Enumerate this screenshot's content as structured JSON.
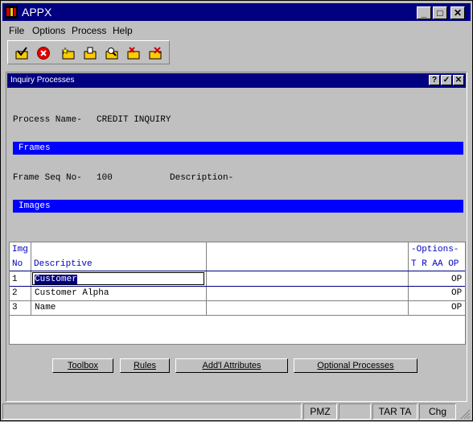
{
  "window": {
    "title": "APPX"
  },
  "menu": [
    "File",
    "Options",
    "Process",
    "Help"
  ],
  "toolbar_icons": [
    "check-folder-icon",
    "cancel-icon",
    "folder-star-icon",
    "folder-edit-icon",
    "folder-search-icon",
    "folder-delete-icon",
    "folder-x-icon"
  ],
  "inner": {
    "title": "Inquiry Processes",
    "buttons": [
      "?",
      "✓",
      "✕"
    ]
  },
  "process": {
    "label": "Process Name-",
    "value": "CREDIT INQUIRY"
  },
  "frames_band": "Frames",
  "frame": {
    "seq_label": "Frame Seq No-",
    "seq_value": "100",
    "desc_label": "Description-"
  },
  "images_band": "Images",
  "grid": {
    "header": {
      "img": "Img",
      "no": "No",
      "descriptive": "Descriptive",
      "options_title": "-Options-",
      "options_cols": "T R AA OP"
    },
    "rows": [
      {
        "no": "1",
        "descriptive": "Customer",
        "opt": "OP"
      },
      {
        "no": "2",
        "descriptive": "Customer Alpha",
        "opt": "OP"
      },
      {
        "no": "3",
        "descriptive": "Name",
        "opt": "OP"
      }
    ]
  },
  "buttons": {
    "toolbox": "Toolbox",
    "rules": "Rules",
    "addl": "Add'l Attributes",
    "optional": "Optional Processes"
  },
  "status": {
    "s1": "",
    "s2": "",
    "pmz": "PMZ",
    "s3": "",
    "tar": "TAR TA",
    "chg": "Chg"
  }
}
